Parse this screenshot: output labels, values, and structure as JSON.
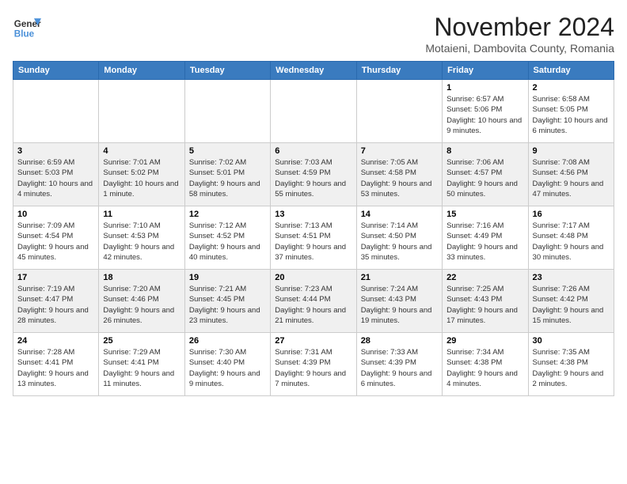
{
  "logo": {
    "line1": "General",
    "line2": "Blue"
  },
  "title": "November 2024",
  "subtitle": "Motaieni, Dambovita County, Romania",
  "days_of_week": [
    "Sunday",
    "Monday",
    "Tuesday",
    "Wednesday",
    "Thursday",
    "Friday",
    "Saturday"
  ],
  "weeks": [
    [
      {
        "day": "",
        "info": ""
      },
      {
        "day": "",
        "info": ""
      },
      {
        "day": "",
        "info": ""
      },
      {
        "day": "",
        "info": ""
      },
      {
        "day": "",
        "info": ""
      },
      {
        "day": "1",
        "info": "Sunrise: 6:57 AM\nSunset: 5:06 PM\nDaylight: 10 hours and 9 minutes."
      },
      {
        "day": "2",
        "info": "Sunrise: 6:58 AM\nSunset: 5:05 PM\nDaylight: 10 hours and 6 minutes."
      }
    ],
    [
      {
        "day": "3",
        "info": "Sunrise: 6:59 AM\nSunset: 5:03 PM\nDaylight: 10 hours and 4 minutes."
      },
      {
        "day": "4",
        "info": "Sunrise: 7:01 AM\nSunset: 5:02 PM\nDaylight: 10 hours and 1 minute."
      },
      {
        "day": "5",
        "info": "Sunrise: 7:02 AM\nSunset: 5:01 PM\nDaylight: 9 hours and 58 minutes."
      },
      {
        "day": "6",
        "info": "Sunrise: 7:03 AM\nSunset: 4:59 PM\nDaylight: 9 hours and 55 minutes."
      },
      {
        "day": "7",
        "info": "Sunrise: 7:05 AM\nSunset: 4:58 PM\nDaylight: 9 hours and 53 minutes."
      },
      {
        "day": "8",
        "info": "Sunrise: 7:06 AM\nSunset: 4:57 PM\nDaylight: 9 hours and 50 minutes."
      },
      {
        "day": "9",
        "info": "Sunrise: 7:08 AM\nSunset: 4:56 PM\nDaylight: 9 hours and 47 minutes."
      }
    ],
    [
      {
        "day": "10",
        "info": "Sunrise: 7:09 AM\nSunset: 4:54 PM\nDaylight: 9 hours and 45 minutes."
      },
      {
        "day": "11",
        "info": "Sunrise: 7:10 AM\nSunset: 4:53 PM\nDaylight: 9 hours and 42 minutes."
      },
      {
        "day": "12",
        "info": "Sunrise: 7:12 AM\nSunset: 4:52 PM\nDaylight: 9 hours and 40 minutes."
      },
      {
        "day": "13",
        "info": "Sunrise: 7:13 AM\nSunset: 4:51 PM\nDaylight: 9 hours and 37 minutes."
      },
      {
        "day": "14",
        "info": "Sunrise: 7:14 AM\nSunset: 4:50 PM\nDaylight: 9 hours and 35 minutes."
      },
      {
        "day": "15",
        "info": "Sunrise: 7:16 AM\nSunset: 4:49 PM\nDaylight: 9 hours and 33 minutes."
      },
      {
        "day": "16",
        "info": "Sunrise: 7:17 AM\nSunset: 4:48 PM\nDaylight: 9 hours and 30 minutes."
      }
    ],
    [
      {
        "day": "17",
        "info": "Sunrise: 7:19 AM\nSunset: 4:47 PM\nDaylight: 9 hours and 28 minutes."
      },
      {
        "day": "18",
        "info": "Sunrise: 7:20 AM\nSunset: 4:46 PM\nDaylight: 9 hours and 26 minutes."
      },
      {
        "day": "19",
        "info": "Sunrise: 7:21 AM\nSunset: 4:45 PM\nDaylight: 9 hours and 23 minutes."
      },
      {
        "day": "20",
        "info": "Sunrise: 7:23 AM\nSunset: 4:44 PM\nDaylight: 9 hours and 21 minutes."
      },
      {
        "day": "21",
        "info": "Sunrise: 7:24 AM\nSunset: 4:43 PM\nDaylight: 9 hours and 19 minutes."
      },
      {
        "day": "22",
        "info": "Sunrise: 7:25 AM\nSunset: 4:43 PM\nDaylight: 9 hours and 17 minutes."
      },
      {
        "day": "23",
        "info": "Sunrise: 7:26 AM\nSunset: 4:42 PM\nDaylight: 9 hours and 15 minutes."
      }
    ],
    [
      {
        "day": "24",
        "info": "Sunrise: 7:28 AM\nSunset: 4:41 PM\nDaylight: 9 hours and 13 minutes."
      },
      {
        "day": "25",
        "info": "Sunrise: 7:29 AM\nSunset: 4:41 PM\nDaylight: 9 hours and 11 minutes."
      },
      {
        "day": "26",
        "info": "Sunrise: 7:30 AM\nSunset: 4:40 PM\nDaylight: 9 hours and 9 minutes."
      },
      {
        "day": "27",
        "info": "Sunrise: 7:31 AM\nSunset: 4:39 PM\nDaylight: 9 hours and 7 minutes."
      },
      {
        "day": "28",
        "info": "Sunrise: 7:33 AM\nSunset: 4:39 PM\nDaylight: 9 hours and 6 minutes."
      },
      {
        "day": "29",
        "info": "Sunrise: 7:34 AM\nSunset: 4:38 PM\nDaylight: 9 hours and 4 minutes."
      },
      {
        "day": "30",
        "info": "Sunrise: 7:35 AM\nSunset: 4:38 PM\nDaylight: 9 hours and 2 minutes."
      }
    ]
  ]
}
